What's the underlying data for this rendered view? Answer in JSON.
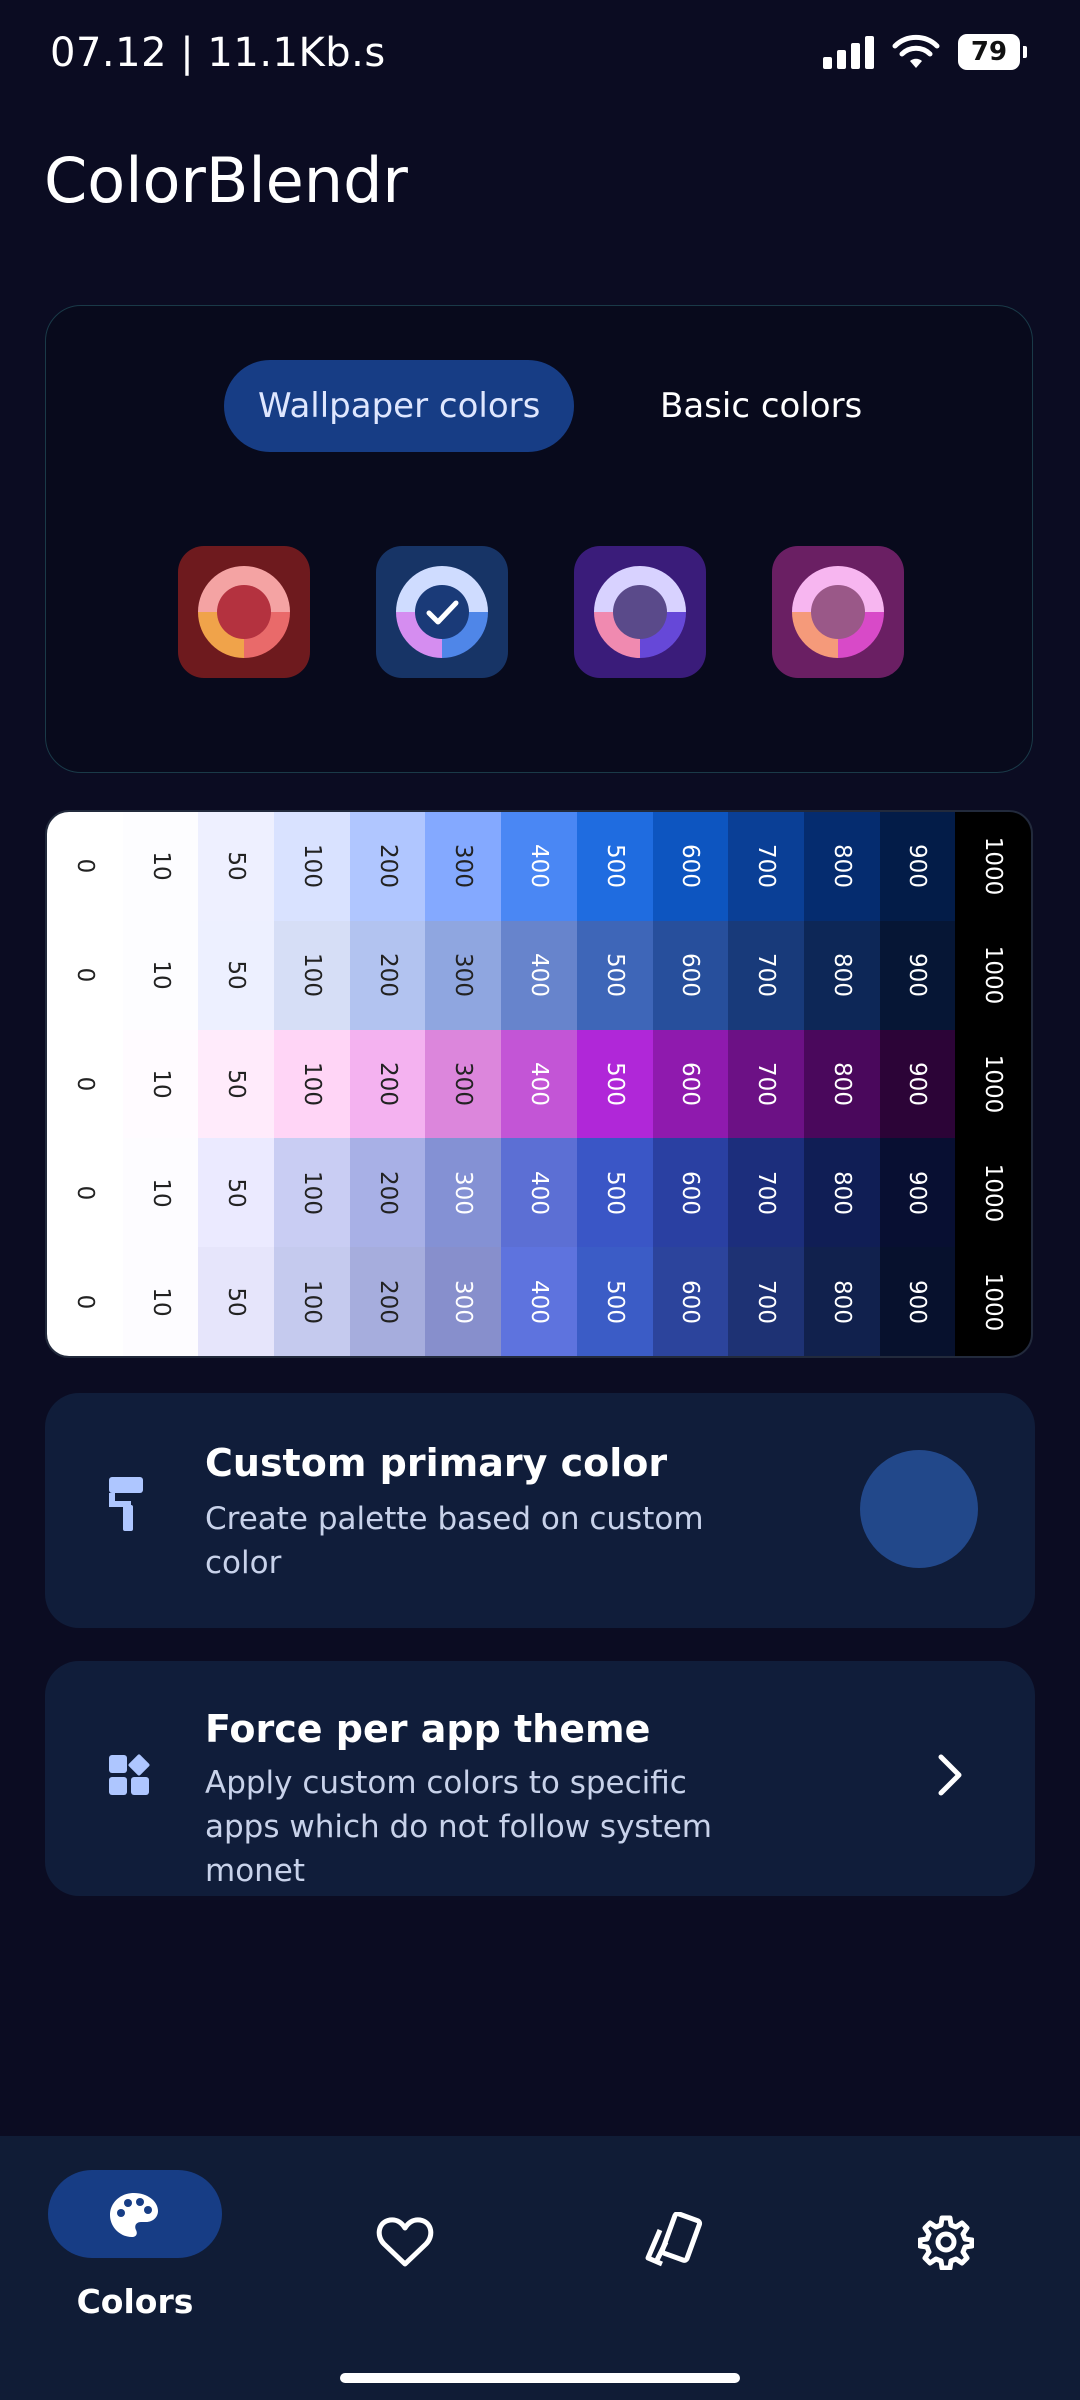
{
  "status_bar": {
    "time": "07.12 | 11.1Kb.s",
    "battery": "79"
  },
  "app": {
    "title": "ColorBlendr"
  },
  "palette_source": {
    "tabs": [
      {
        "label": "Wallpaper colors",
        "selected": true
      },
      {
        "label": "Basic colors",
        "selected": false
      }
    ],
    "swatches": [
      {
        "name": "red",
        "background": "#6e1a1e",
        "ring_top": "#f4a3a3",
        "ring_bl": "#f0a34a",
        "ring_br": "#e96a6a",
        "center": "#b4323f",
        "selected": false
      },
      {
        "name": "blue",
        "background": "#173466",
        "ring_top": "#cfdcff",
        "ring_bl": "#d58df0",
        "ring_br": "#4f86e8",
        "center": "#1a3a78",
        "selected": true
      },
      {
        "name": "violet",
        "background": "#3a1c7a",
        "ring_top": "#d8d2ff",
        "ring_bl": "#f08ab0",
        "ring_br": "#6648d8",
        "center": "#5a4a8a",
        "selected": false
      },
      {
        "name": "pink",
        "background": "#6a1f63",
        "ring_top": "#f7b6f0",
        "ring_bl": "#f59a7a",
        "ring_br": "#d84ac8",
        "center": "#9a5888",
        "selected": false
      }
    ]
  },
  "tone_grid": {
    "labels": [
      "0",
      "10",
      "50",
      "100",
      "200",
      "300",
      "400",
      "500",
      "600",
      "700",
      "800",
      "900",
      "1000"
    ],
    "rows": [
      [
        "#ffffff",
        "#fdfdff",
        "#eef0ff",
        "#d9e2ff",
        "#b0c6ff",
        "#84a9ff",
        "#4a87f4",
        "#1f6ce0",
        "#0d55c0",
        "#0a3f96",
        "#052c6f",
        "#031c48",
        "#000000"
      ],
      [
        "#ffffff",
        "#fdfdff",
        "#edf0ff",
        "#d6def6",
        "#b2c3f0",
        "#8fa6e0",
        "#6784cc",
        "#3e66b8",
        "#274f9c",
        "#183a7a",
        "#0d2757",
        "#061635",
        "#000000"
      ],
      [
        "#ffffff",
        "#fffbff",
        "#ffebfb",
        "#ffd5f6",
        "#f4b2f0",
        "#dc86dc",
        "#c355d6",
        "#b027d8",
        "#8f1aae",
        "#6c1185",
        "#4a085c",
        "#2c0437",
        "#000000"
      ],
      [
        "#ffffff",
        "#fdfcff",
        "#ebeaff",
        "#c9cdf3",
        "#a8b0e6",
        "#8491d4",
        "#5c6fd4",
        "#3a56c6",
        "#2a40a2",
        "#1c2e7c",
        "#101e55",
        "#080f32",
        "#000000"
      ],
      [
        "#ffffff",
        "#fdfcff",
        "#e6e5fb",
        "#c5caee",
        "#a6addd",
        "#878fcc",
        "#5e73de",
        "#3b5cc6",
        "#2c449c",
        "#1e3274",
        "#11214d",
        "#07112d",
        "#000000"
      ]
    ]
  },
  "cards": {
    "custom_primary": {
      "title": "Custom primary color",
      "subtitle": "Create palette based on custom color",
      "color": "#22488a"
    },
    "per_app": {
      "title": "Force per app theme",
      "subtitle": "Apply custom colors to specific apps which do not follow system monet"
    }
  },
  "bottom_nav": {
    "items": [
      {
        "label": "Colors",
        "icon": "palette-icon",
        "selected": true
      },
      {
        "label": "",
        "icon": "heart-icon",
        "selected": false
      },
      {
        "label": "",
        "icon": "themes-icon",
        "selected": false
      },
      {
        "label": "",
        "icon": "gear-icon",
        "selected": false
      }
    ]
  }
}
